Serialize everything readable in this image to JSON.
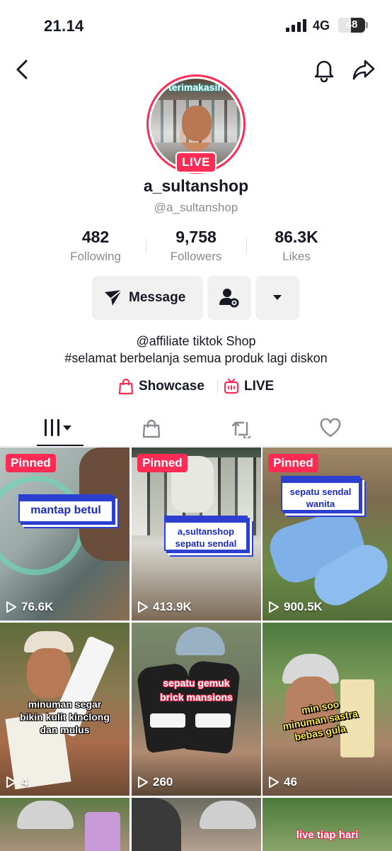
{
  "status_bar": {
    "time": "21.14",
    "network": "4G",
    "battery": "48",
    "battery_level": 0.48
  },
  "nav": {
    "back_icon": "chevron-left-icon",
    "bell_icon": "bell-icon",
    "share_icon": "share-arrow-icon"
  },
  "profile": {
    "avatar_overlay_text": "terimakasih",
    "live_badge": "LIVE",
    "username": "a_sultanshop",
    "handle": "@a_sultanshop",
    "stats": [
      {
        "value": "482",
        "label": "Following"
      },
      {
        "value": "9,758",
        "label": "Followers"
      },
      {
        "value": "86.3K",
        "label": "Likes"
      }
    ],
    "message_label": "Message",
    "bio_line1": "@affiliate tiktok Shop",
    "bio_line2": "#selamat berbelanja semua produk lagi diskon",
    "links": [
      {
        "label": "Showcase",
        "icon": "shopping-bag-icon"
      },
      {
        "label": "LIVE",
        "icon": "live-tv-icon"
      }
    ]
  },
  "tabs": [
    {
      "name": "videos",
      "icon": "grid-bars-icon"
    },
    {
      "name": "shop",
      "icon": "shopping-bag-icon"
    },
    {
      "name": "reposts",
      "icon": "repost-icon"
    },
    {
      "name": "liked",
      "icon": "heart-icon"
    }
  ],
  "colors": {
    "accent": "#fe2c55",
    "card_blue": "#2c3fcf",
    "secondary_text": "#8a8b91"
  },
  "videos": [
    {
      "pinned": "Pinned",
      "views": "76.6K",
      "caption": "mantap betul"
    },
    {
      "pinned": "Pinned",
      "views": "413.9K",
      "caption_line1": "a,sultanshop",
      "caption_line2": "sepatu sendal"
    },
    {
      "pinned": "Pinned",
      "views": "900.5K",
      "caption_line1": "sepatu sendal",
      "caption_line2": "wanita"
    },
    {
      "views": "4",
      "caption_line1": "minuman segar",
      "caption_line2": "bikin kulit kinclong",
      "caption_line3": "dan mulus"
    },
    {
      "views": "260",
      "caption_line1": "sepatu gemuk",
      "caption_line2": "brick mansions"
    },
    {
      "views": "46",
      "caption_line1": "min soo",
      "caption_line2": "minuman sastra",
      "caption_line3": "bebas gula"
    },
    {},
    {},
    {
      "caption_line1": "live tiap hari"
    }
  ]
}
